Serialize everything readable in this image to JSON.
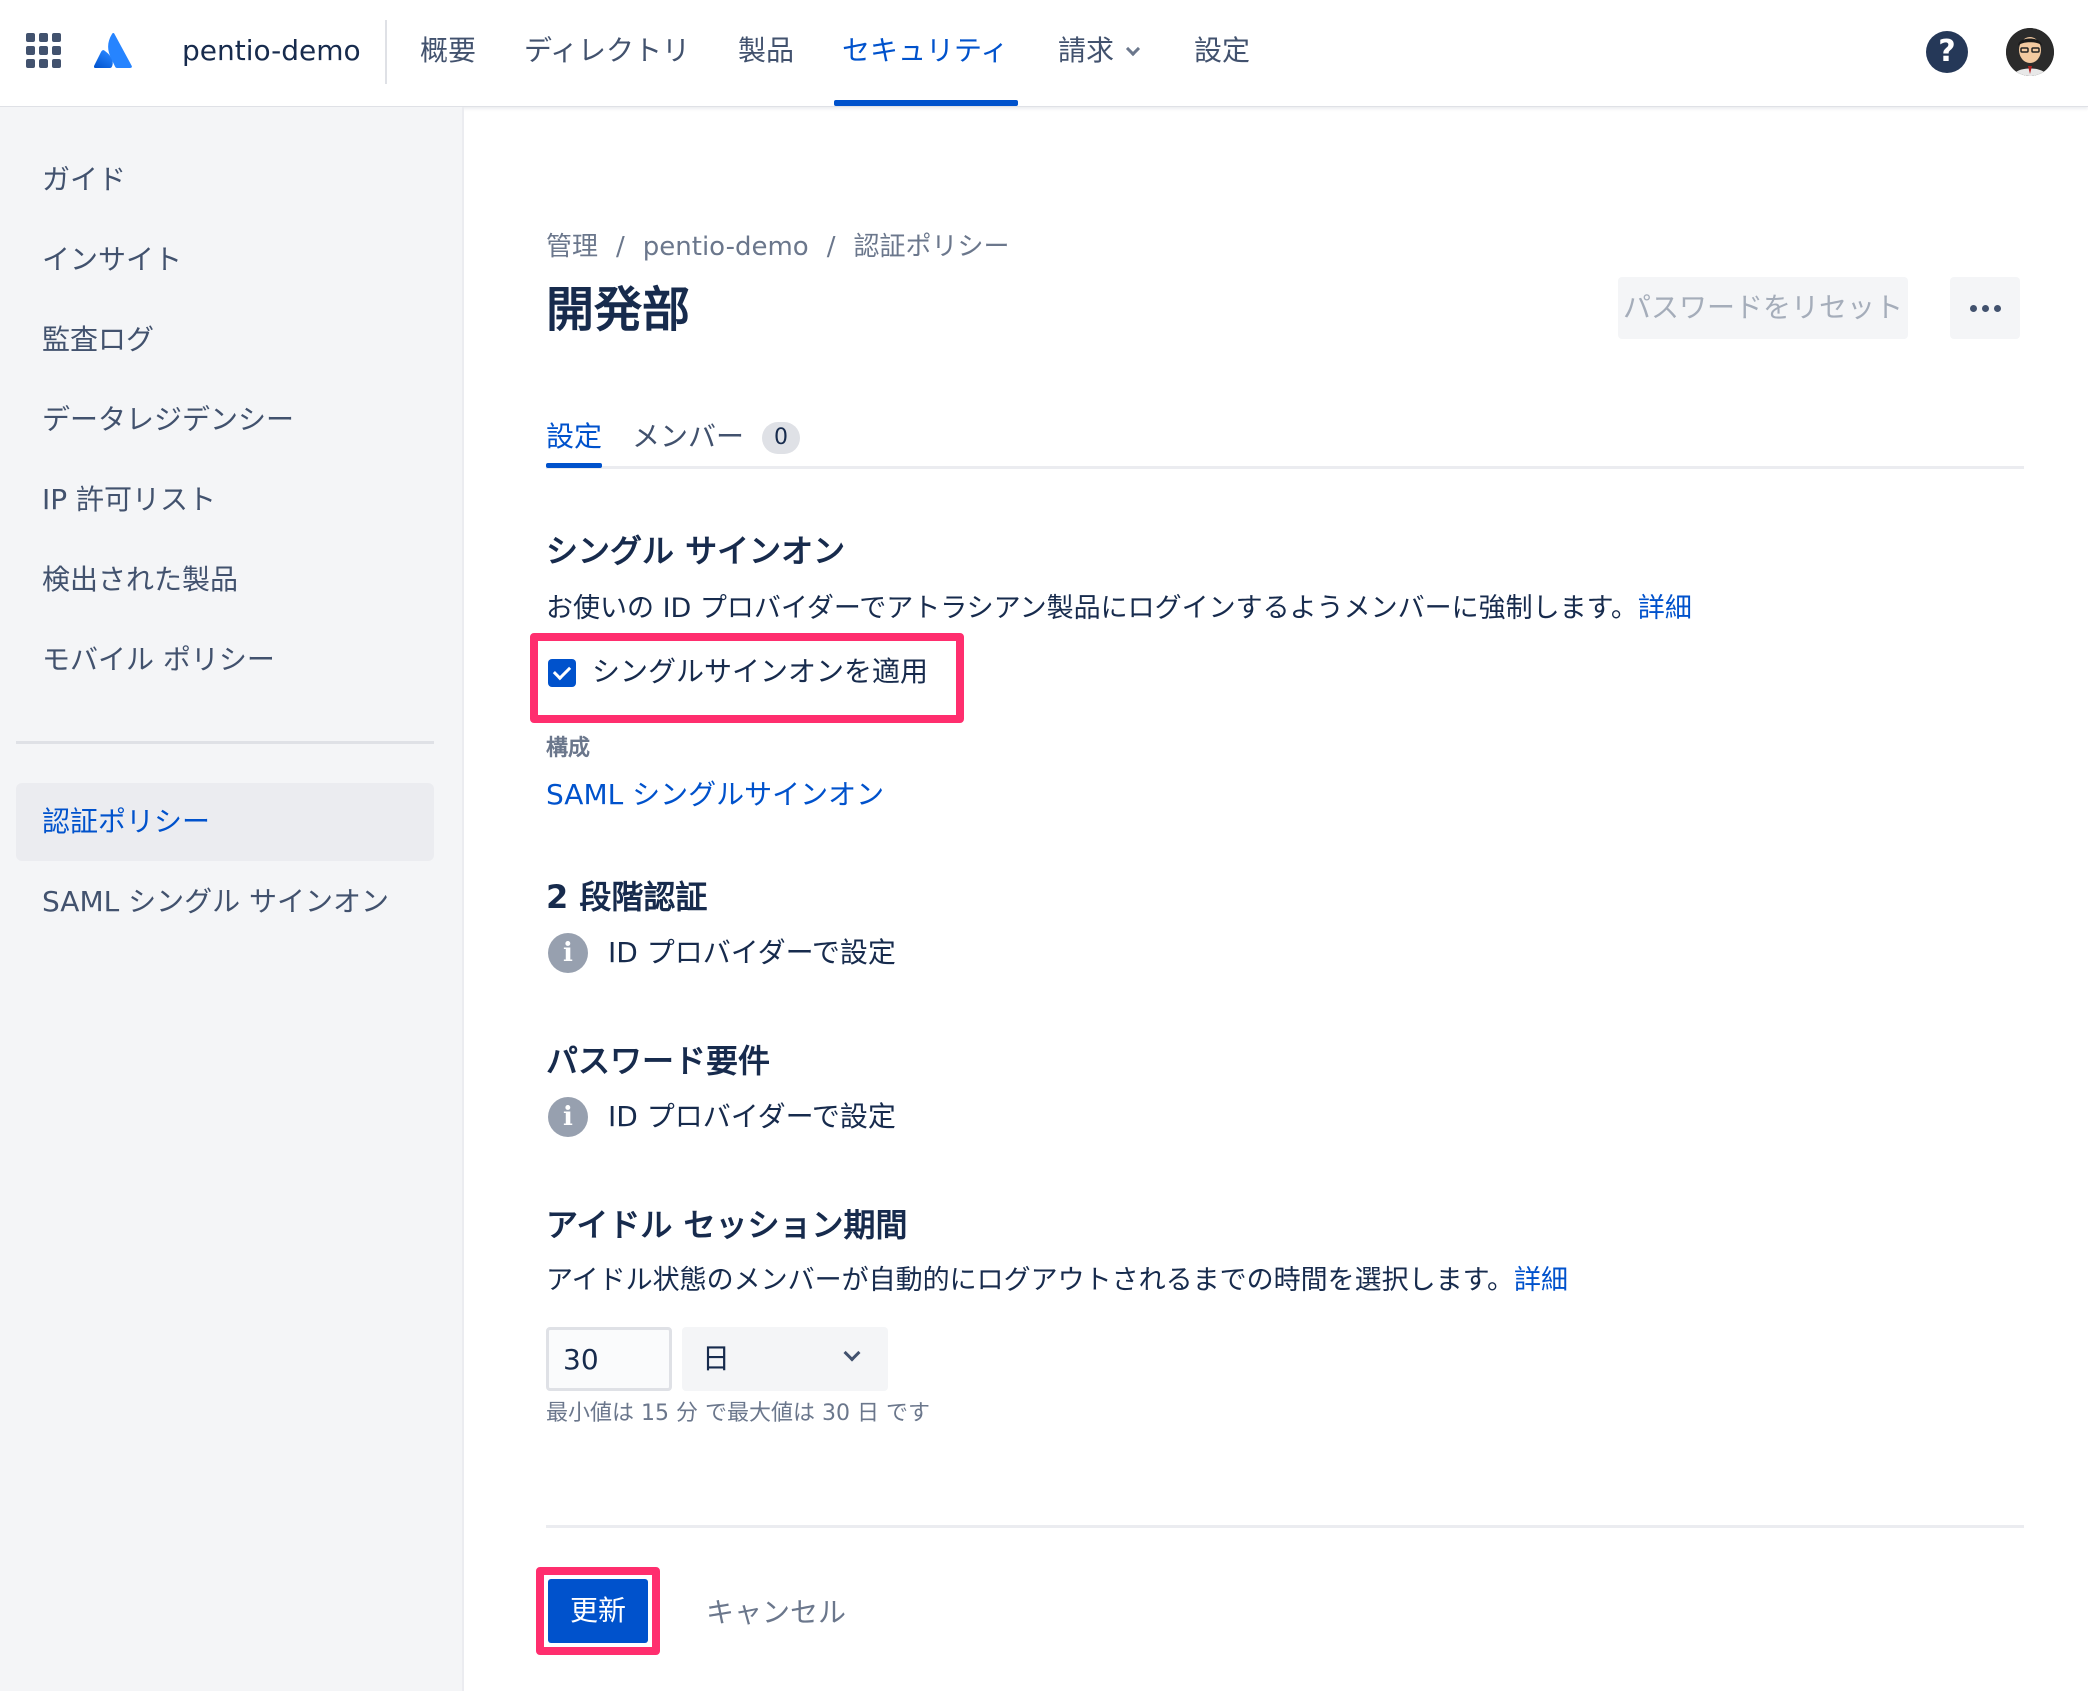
{
  "nav": {
    "org": "pentio-demo",
    "items": [
      "概要",
      "ディレクトリ",
      "製品",
      "セキュリティ",
      "請求",
      "設定"
    ],
    "active": "セキュリティ",
    "help": "?"
  },
  "sidebar": {
    "items": [
      "ガイド",
      "インサイト",
      "監査ログ",
      "データレジデンシー",
      "IP 許可リスト",
      "検出された製品",
      "モバイル ポリシー"
    ],
    "policy_items": [
      "認証ポリシー",
      "SAML シングル サインオン"
    ],
    "selected": "認証ポリシー"
  },
  "breadcrumb": [
    "管理",
    "pentio-demo",
    "認証ポリシー"
  ],
  "breadcrumb_sep": "/",
  "page": {
    "title": "開発部",
    "reset_button": "パスワードをリセット"
  },
  "tabs": {
    "settings": "設定",
    "members": "メンバー",
    "members_count": "0"
  },
  "sso": {
    "title": "シングル サインオン",
    "desc": "お使いの ID プロバイダーでアトラシアン製品にログインするようメンバーに強制します。",
    "link": "詳細",
    "checkbox_label": "シングルサインオンを適用",
    "checked": true,
    "config_label": "構成",
    "config_link": "SAML シングルサインオン"
  },
  "two_factor": {
    "title": "2 段階認証",
    "info": "ID プロバイダーで設定"
  },
  "password": {
    "title": "パスワード要件",
    "info": "ID プロバイダーで設定"
  },
  "idle": {
    "title": "アイドル セッション期間",
    "desc": "アイドル状態のメンバーが自動的にログアウトされるまでの時間を選択します。",
    "link": "詳細",
    "value": "30",
    "unit": "日",
    "hint": "最小値は 15 分 で最大値は 30 日 です"
  },
  "footer": {
    "update": "更新",
    "cancel": "キャンセル"
  },
  "colors": {
    "accent": "#0052cc",
    "highlight": "#ff2e6e"
  },
  "icons": [
    "app-switcher-icon",
    "atlassian-logo-icon",
    "chevron-down-icon",
    "help-icon",
    "info-icon",
    "more-icon"
  ]
}
